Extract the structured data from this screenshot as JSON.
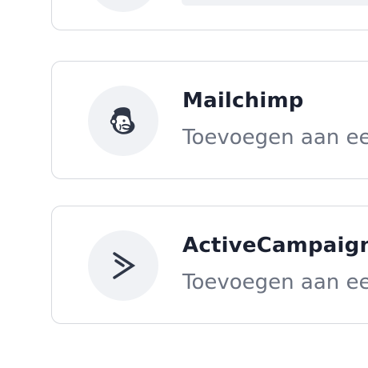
{
  "integrations": {
    "items": [
      {
        "name": "Mailchimp",
        "description": "Toevoegen aan ee",
        "icon": "mailchimp-icon"
      },
      {
        "name": "ActiveCampaign",
        "description": "Toevoegen aan ee",
        "icon": "activecampaign-icon"
      }
    ]
  },
  "colors": {
    "title": "#1b2131",
    "description": "#6b7280",
    "icon_bg": "#f0f2f5",
    "border": "#d6d9de",
    "icon": "#2f3747"
  }
}
